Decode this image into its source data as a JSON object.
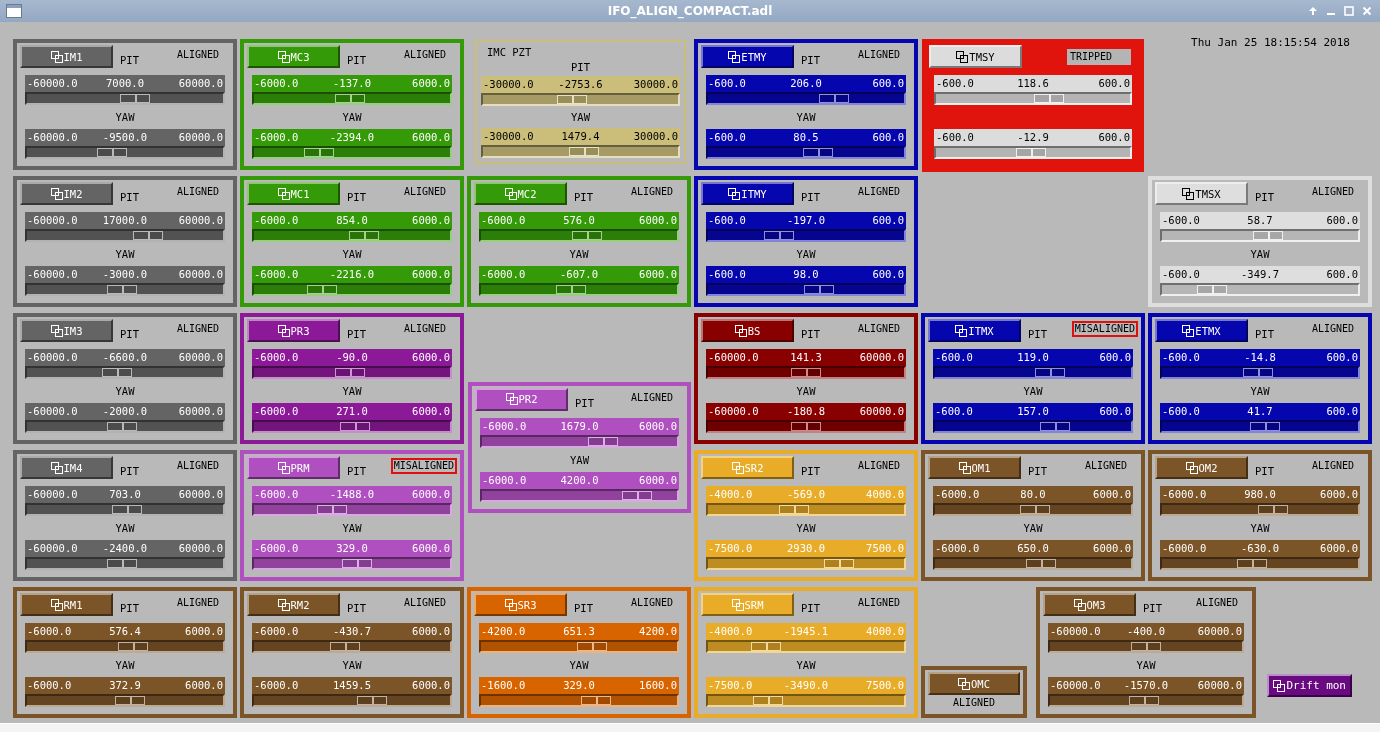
{
  "window": {
    "title": "IFO_ALIGN_COMPACT.adl"
  },
  "clock": "Thu Jan 25 18:15:54 2018",
  "panels": [
    {
      "kind": "mirror",
      "name": "IM1",
      "color": "#646464",
      "status": {
        "text": "ALIGNED",
        "kind": "ok"
      },
      "sliders": [
        {
          "label": "PIT",
          "min": "-60000.0",
          "value": "7000.0",
          "max": "60000.0",
          "level": 0.56
        },
        {
          "label": "YAW",
          "min": "-60000.0",
          "value": "-9500.0",
          "max": "60000.0",
          "level": 0.42
        }
      ]
    },
    {
      "kind": "mirror",
      "name": "MC3",
      "color": "#359a08",
      "status": {
        "text": "ALIGNED",
        "kind": "ok"
      },
      "sliders": [
        {
          "label": "PIT",
          "min": "-6000.0",
          "value": "-137.0",
          "max": "6000.0",
          "level": 0.49
        },
        {
          "label": "YAW",
          "min": "-6000.0",
          "value": "-2394.0",
          "max": "6000.0",
          "level": 0.3
        }
      ]
    },
    {
      "kind": "pzt",
      "title": "IMC PZT",
      "color": "#cbbd7a",
      "sliders": [
        {
          "label": "PIT",
          "min": "-30000.0",
          "value": "-2753.6",
          "max": "30000.0",
          "level": 0.45
        },
        {
          "label": "YAW",
          "min": "-30000.0",
          "value": "1479.4",
          "max": "30000.0",
          "level": 0.52
        }
      ]
    },
    {
      "kind": "mirror",
      "name": "ETMY",
      "color": "#0606ae",
      "status": {
        "text": "ALIGNED",
        "kind": "ok"
      },
      "sliders": [
        {
          "label": "PIT",
          "min": "-600.0",
          "value": "206.0",
          "max": "600.0",
          "level": 0.67
        },
        {
          "label": "YAW",
          "min": "-600.0",
          "value": "80.5",
          "max": "600.0",
          "level": 0.57
        }
      ]
    },
    {
      "kind": "mirror",
      "name": "TMSY",
      "filled": true,
      "color": "#e0140c",
      "status": {
        "text": "TRIPPED",
        "kind": "tripped"
      },
      "sliders": [
        {
          "min": "-600.0",
          "value": "118.6",
          "max": "600.0",
          "level": 0.6
        },
        {
          "min": "-600.0",
          "value": "-12.9",
          "max": "600.0",
          "level": 0.49
        }
      ]
    },
    {
      "kind": "mirror",
      "name": "IM2",
      "color": "#646464",
      "status": {
        "text": "ALIGNED",
        "kind": "ok"
      },
      "sliders": [
        {
          "label": "PIT",
          "min": "-60000.0",
          "value": "17000.0",
          "max": "60000.0",
          "level": 0.64
        },
        {
          "label": "YAW",
          "min": "-60000.0",
          "value": "-3000.0",
          "max": "60000.0",
          "level": 0.48
        }
      ]
    },
    {
      "kind": "mirror",
      "name": "MC1",
      "color": "#359a08",
      "status": {
        "text": "ALIGNED",
        "kind": "ok"
      },
      "sliders": [
        {
          "label": "PIT",
          "min": "-6000.0",
          "value": "854.0",
          "max": "6000.0",
          "level": 0.57
        },
        {
          "label": "YAW",
          "min": "-6000.0",
          "value": "-2216.0",
          "max": "6000.0",
          "level": 0.32
        }
      ]
    },
    {
      "kind": "mirror",
      "name": "MC2",
      "color": "#359a08",
      "status": {
        "text": "ALIGNED",
        "kind": "ok"
      },
      "sliders": [
        {
          "label": "PIT",
          "min": "-6000.0",
          "value": "576.0",
          "max": "6000.0",
          "level": 0.55
        },
        {
          "label": "YAW",
          "min": "-6000.0",
          "value": "-607.0",
          "max": "6000.0",
          "level": 0.45
        }
      ]
    },
    {
      "kind": "mirror",
      "name": "ITMY",
      "color": "#0606ae",
      "status": {
        "text": "ALIGNED",
        "kind": "ok"
      },
      "sliders": [
        {
          "label": "PIT",
          "min": "-600.0",
          "value": "-197.0",
          "max": "600.0",
          "level": 0.34
        },
        {
          "label": "YAW",
          "min": "-600.0",
          "value": "98.0",
          "max": "600.0",
          "level": 0.58
        }
      ]
    },
    {
      "kind": "mirror",
      "name": "TMSX",
      "color": "#dedede",
      "status": {
        "text": "ALIGNED",
        "kind": "ok"
      },
      "sliders": [
        {
          "label": "PIT",
          "min": "-600.0",
          "value": "58.7",
          "max": "600.0",
          "level": 0.55
        },
        {
          "label": "YAW",
          "min": "-600.0",
          "value": "-349.7",
          "max": "600.0",
          "level": 0.21
        }
      ]
    },
    {
      "kind": "mirror",
      "name": "IM3",
      "color": "#646464",
      "status": {
        "text": "ALIGNED",
        "kind": "ok"
      },
      "sliders": [
        {
          "label": "PIT",
          "min": "-60000.0",
          "value": "-6600.0",
          "max": "60000.0",
          "level": 0.45
        },
        {
          "label": "YAW",
          "min": "-60000.0",
          "value": "-2000.0",
          "max": "60000.0",
          "level": 0.48
        }
      ]
    },
    {
      "kind": "mirror",
      "name": "PR3",
      "color": "#8c1a98",
      "status": {
        "text": "ALIGNED",
        "kind": "ok"
      },
      "sliders": [
        {
          "label": "PIT",
          "min": "-6000.0",
          "value": "-90.0",
          "max": "6000.0",
          "level": 0.49
        },
        {
          "label": "YAW",
          "min": "-6000.0",
          "value": "271.0",
          "max": "6000.0",
          "level": 0.52
        }
      ]
    },
    {
      "kind": "mirror",
      "name": "BS",
      "color": "#880000",
      "status": {
        "text": "ALIGNED",
        "kind": "ok"
      },
      "sliders": [
        {
          "label": "PIT",
          "min": "-60000.0",
          "value": "141.3",
          "max": "60000.0",
          "level": 0.5
        },
        {
          "label": "YAW",
          "min": "-60000.0",
          "value": "-180.8",
          "max": "60000.0",
          "level": 0.5
        }
      ]
    },
    {
      "kind": "mirror",
      "name": "ITMX",
      "color": "#0606ae",
      "status": {
        "text": "MISALIGNED",
        "kind": "alarm"
      },
      "sliders": [
        {
          "label": "PIT",
          "min": "-600.0",
          "value": "119.0",
          "max": "600.0",
          "level": 0.6
        },
        {
          "label": "YAW",
          "min": "-600.0",
          "value": "157.0",
          "max": "600.0",
          "level": 0.63
        }
      ]
    },
    {
      "kind": "mirror",
      "name": "ETMX",
      "color": "#0606ae",
      "status": {
        "text": "ALIGNED",
        "kind": "ok"
      },
      "sliders": [
        {
          "label": "PIT",
          "min": "-600.0",
          "value": "-14.8",
          "max": "600.0",
          "level": 0.49
        },
        {
          "label": "YAW",
          "min": "-600.0",
          "value": "41.7",
          "max": "600.0",
          "level": 0.53
        }
      ]
    },
    {
      "kind": "mirror",
      "name": "PR2",
      "color": "#b050c0",
      "status": {
        "text": "ALIGNED",
        "kind": "ok"
      },
      "sliders": [
        {
          "label": "PIT",
          "min": "-6000.0",
          "value": "1679.0",
          "max": "6000.0",
          "level": 0.64
        },
        {
          "label": "YAW",
          "min": "-6000.0",
          "value": "4200.0",
          "max": "6000.0",
          "level": 0.85
        }
      ]
    },
    {
      "kind": "mirror",
      "name": "IM4",
      "color": "#646464",
      "status": {
        "text": "ALIGNED",
        "kind": "ok"
      },
      "sliders": [
        {
          "label": "PIT",
          "min": "-60000.0",
          "value": "703.0",
          "max": "60000.0",
          "level": 0.51
        },
        {
          "label": "YAW",
          "min": "-60000.0",
          "value": "-2400.0",
          "max": "60000.0",
          "level": 0.48
        }
      ]
    },
    {
      "kind": "mirror",
      "name": "PRM",
      "color": "#b050c0",
      "status": {
        "text": "MISALIGNED",
        "kind": "alarm"
      },
      "sliders": [
        {
          "label": "PIT",
          "min": "-6000.0",
          "value": "-1488.0",
          "max": "6000.0",
          "level": 0.38
        },
        {
          "label": "YAW",
          "min": "-6000.0",
          "value": "329.0",
          "max": "6000.0",
          "level": 0.53
        }
      ]
    },
    {
      "kind": "mirror",
      "name": "SR2",
      "color": "#e8ac28",
      "status": {
        "text": "ALIGNED",
        "kind": "ok"
      },
      "sliders": [
        {
          "label": "PIT",
          "min": "-4000.0",
          "value": "-569.0",
          "max": "4000.0",
          "level": 0.43
        },
        {
          "label": "YAW",
          "min": "-7500.0",
          "value": "2930.0",
          "max": "7500.0",
          "level": 0.7
        }
      ]
    },
    {
      "kind": "mirror",
      "name": "OM1",
      "color": "#7b5428",
      "status": {
        "text": "ALIGNED",
        "kind": "ok"
      },
      "sliders": [
        {
          "label": "PIT",
          "min": "-6000.0",
          "value": "80.0",
          "max": "6000.0",
          "level": 0.51
        },
        {
          "label": "YAW",
          "min": "-6000.0",
          "value": "650.0",
          "max": "6000.0",
          "level": 0.55
        }
      ]
    },
    {
      "kind": "mirror",
      "name": "OM2",
      "color": "#7b5428",
      "status": {
        "text": "ALIGNED",
        "kind": "ok"
      },
      "sliders": [
        {
          "label": "PIT",
          "min": "-6000.0",
          "value": "980.0",
          "max": "6000.0",
          "level": 0.58
        },
        {
          "label": "YAW",
          "min": "-6000.0",
          "value": "-630.0",
          "max": "6000.0",
          "level": 0.45
        }
      ]
    },
    {
      "kind": "mirror",
      "name": "RM1",
      "color": "#7b5428",
      "status": {
        "text": "ALIGNED",
        "kind": "ok"
      },
      "sliders": [
        {
          "label": "PIT",
          "min": "-6000.0",
          "value": "576.4",
          "max": "6000.0",
          "level": 0.55
        },
        {
          "label": "YAW",
          "min": "-6000.0",
          "value": "372.9",
          "max": "6000.0",
          "level": 0.53
        }
      ]
    },
    {
      "kind": "mirror",
      "name": "RM2",
      "color": "#7b5428",
      "status": {
        "text": "ALIGNED",
        "kind": "ok"
      },
      "sliders": [
        {
          "label": "PIT",
          "min": "-6000.0",
          "value": "-430.7",
          "max": "6000.0",
          "level": 0.46
        },
        {
          "label": "YAW",
          "min": "-6000.0",
          "value": "1459.5",
          "max": "6000.0",
          "level": 0.62
        }
      ]
    },
    {
      "kind": "mirror",
      "name": "SR3",
      "color": "#d86400",
      "status": {
        "text": "ALIGNED",
        "kind": "ok"
      },
      "sliders": [
        {
          "label": "PIT",
          "min": "-4200.0",
          "value": "651.3",
          "max": "4200.0",
          "level": 0.58
        },
        {
          "label": "YAW",
          "min": "-1600.0",
          "value": "329.0",
          "max": "1600.0",
          "level": 0.6
        }
      ]
    },
    {
      "kind": "mirror",
      "name": "SRM",
      "color": "#e8ac28",
      "status": {
        "text": "ALIGNED",
        "kind": "ok"
      },
      "sliders": [
        {
          "label": "PIT",
          "min": "-4000.0",
          "value": "-1945.1",
          "max": "4000.0",
          "level": 0.26
        },
        {
          "label": "YAW",
          "min": "-7500.0",
          "value": "-3490.0",
          "max": "7500.0",
          "level": 0.27
        }
      ]
    },
    {
      "kind": "display",
      "name": "OMC",
      "color": "#7b5428",
      "status": {
        "text": "ALIGNED",
        "kind": "ok"
      }
    },
    {
      "kind": "mirror",
      "name": "OM3",
      "color": "#7b5428",
      "status": {
        "text": "ALIGNED",
        "kind": "ok"
      },
      "sliders": [
        {
          "label": "PIT",
          "min": "-60000.0",
          "value": "-400.0",
          "max": "60000.0",
          "level": 0.5
        },
        {
          "label": "YAW",
          "min": "-60000.0",
          "value": "-1570.0",
          "max": "60000.0",
          "level": 0.49
        }
      ]
    }
  ],
  "drift_button": {
    "label": "Drift mon",
    "color": "#6a0a80"
  }
}
